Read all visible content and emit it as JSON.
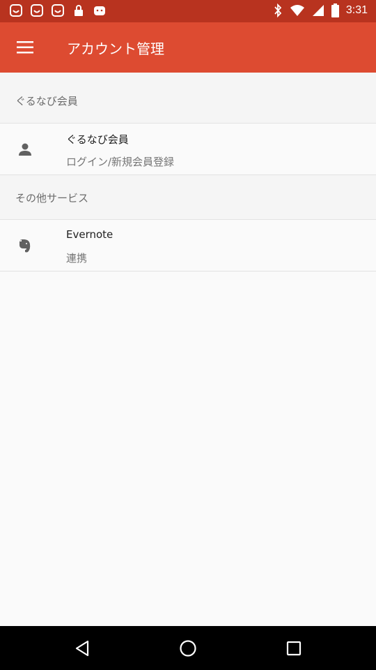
{
  "status_bar": {
    "time": "3:31",
    "left_icons": [
      "smiley-notification-icon",
      "smiley-notification-icon",
      "smiley-notification-icon",
      "lock-notification-icon",
      "smiley-notification-icon"
    ],
    "right_icons": [
      "bluetooth-icon",
      "wifi-icon",
      "signal-icon",
      "battery-icon"
    ]
  },
  "app_bar": {
    "title": "アカウント管理",
    "menu_icon": "menu-icon"
  },
  "sections": [
    {
      "header": "ぐるなび会員",
      "items": [
        {
          "title": "ぐるなび会員",
          "subtitle": "ログイン/新規会員登録",
          "icon": "person-icon"
        }
      ]
    },
    {
      "header": "その他サービス",
      "items": [
        {
          "title": "Evernote",
          "subtitle": "連携",
          "icon": "evernote-icon"
        }
      ]
    }
  ],
  "nav_bar": {
    "buttons": [
      "back-icon",
      "home-icon",
      "recents-icon"
    ]
  },
  "colors": {
    "status_bar": "#b8331f",
    "app_bar": "#dd4b31",
    "background": "#fafafa"
  }
}
